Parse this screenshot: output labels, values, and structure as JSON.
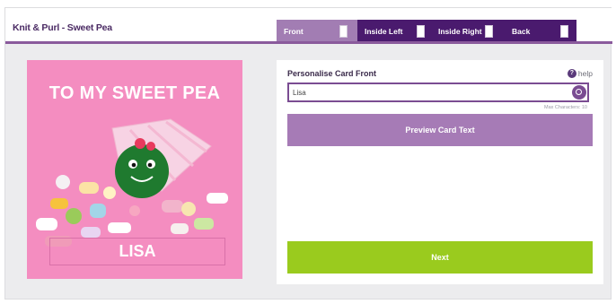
{
  "header": {
    "title": "Knit & Purl - Sweet Pea",
    "tabs": [
      {
        "label": "Front",
        "active": true
      },
      {
        "label": "Inside Left",
        "active": false
      },
      {
        "label": "Inside Right",
        "active": false
      },
      {
        "label": "Back",
        "active": false
      }
    ]
  },
  "card": {
    "headline": "TO MY SWEET PEA",
    "name_text": "LISA",
    "background_color": "#f48dc0"
  },
  "panel": {
    "label": "Personalise Card Front",
    "help_label": "help",
    "help_icon": "help-icon",
    "input_value": "Lisa",
    "max_chars_text": "Max Characters: 10",
    "preview_button": "Preview Card Text",
    "next_button": "Next"
  },
  "colors": {
    "accent_purple": "#4a1a6e",
    "active_tab": "#a27db3",
    "next_green": "#9acb1e"
  }
}
